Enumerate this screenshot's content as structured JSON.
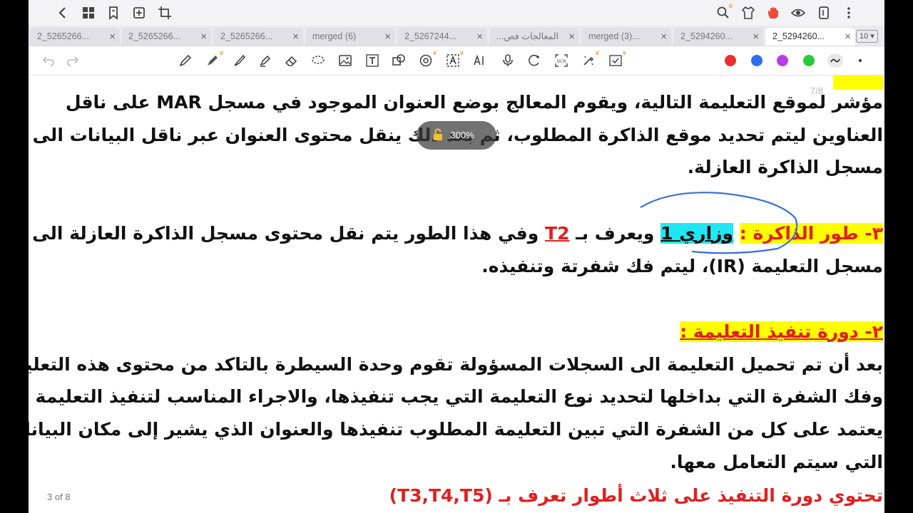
{
  "nav": {
    "left_icons": [
      "chevron-left-icon",
      "grid-icon",
      "bookmark-icon",
      "add-page-icon",
      "crop-icon"
    ],
    "right_icons": [
      "search-icon",
      "shirt-icon",
      "hand-icon",
      "eye-icon",
      "tablet-icon",
      "more-vertical-icon"
    ]
  },
  "tabs": [
    {
      "label": "2_5265266...",
      "active": false
    },
    {
      "label": "2_5265266...",
      "active": false
    },
    {
      "label": "2_5265266...",
      "active": false
    },
    {
      "label": "merged (6)",
      "active": false
    },
    {
      "label": "2_5267244...",
      "active": false
    },
    {
      "label": "المعالجات فص...",
      "active": false
    },
    {
      "label": "merged (3)...",
      "active": false
    },
    {
      "label": "2_5294260...",
      "active": false
    },
    {
      "label": "2_5294260...",
      "active": true
    }
  ],
  "tab_count": "10",
  "tools": [
    "undo-icon",
    "redo-icon",
    "pen-icon",
    "fountain-pen-icon",
    "brush-icon",
    "highlighter-icon",
    "eraser-icon",
    "lasso-icon",
    "image-icon",
    "text-box-icon",
    "shape-icon",
    "stamp-icon",
    "text-recognition-icon",
    "ai-icon",
    "mic-icon",
    "laser-icon",
    "ocr-icon",
    "magic-icon",
    "link-icon"
  ],
  "colors": {
    "red": "#e8302e",
    "blue": "#2f6cf0",
    "purple": "#b63ee8",
    "green": "#2bc83b",
    "accent_text": "#e02020",
    "highlight_yellow": "#ffff00",
    "highlight_cyan": "#22e5f2"
  },
  "zoom": "300%",
  "page_ghost": "7/8",
  "page_indicator": "3 of 8",
  "doc": {
    "l1": "مؤشر لموقع التعليمة التالية، ويقوم المعالج بوضع العنوان الموجود في مسجل MAR على ناقل",
    "l2": "العناوين ليتم تحديد موقع الذاكرة المطلوب، ثم بعد ذلك ينقل محتوى العنوان عبر ناقل البيانات الى",
    "l3": "مسجل الذاكرة العازلة.",
    "s3_num": "٣-",
    "s3_title": " طور الذاكرة :",
    "s3_term": "وزاري 1",
    "s3_mid": " ويعرف بـ ",
    "s3_code": "T2",
    "s3_rest": " وفي هذا الطور يتم نقل محتوى مسجل الذاكرة العازلة الى",
    "l5": "مسجل التعليمة (IR)، ليتم فك شفرتة وتنفيذه.",
    "s2_heading": "٢- دورة تنفيذ التعليمة :",
    "p1": "بعد أن تم تحميل التعليمة الى السجلات المسؤولة تقوم وحدة السيطرة بالتاكد من محتوى هذه التعليمة",
    "p2": "وفك الشفرة التي بداخلها لتحديد نوع التعليمة التي يجب تنفيذها، والاجراء المناسب لتنفيذ التعليمة",
    "p3": "يعتمد على كل من الشفرة التي تبين التعليمة المطلوب تنفيذها والعنوان الذي يشير إلى مكان البيانات",
    "p4": "التي سيتم التعامل معها.",
    "last": "تحتوي دورة التنفيذ على ثلاث أطوار تعرف بـ (T3,T4,T5)"
  }
}
